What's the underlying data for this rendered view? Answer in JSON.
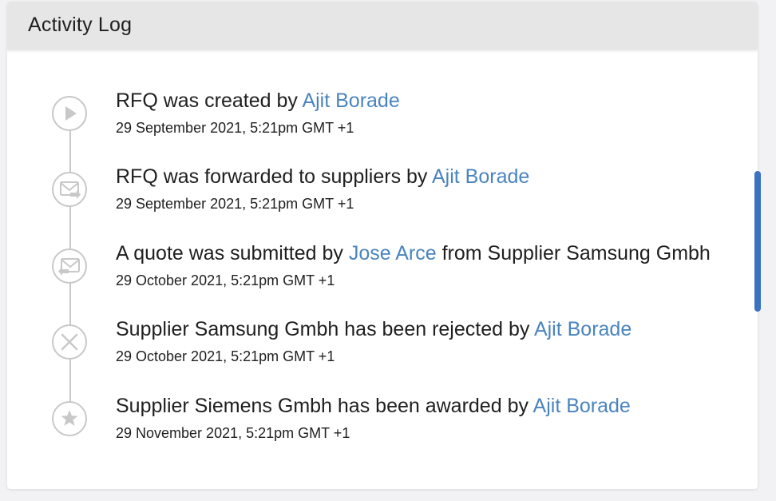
{
  "header": {
    "title": "Activity Log"
  },
  "entries": [
    {
      "icon": "play-icon",
      "text_before": "RFQ was created by ",
      "user": "Ajit Borade",
      "text_after": "",
      "date": "29 September 2021, 5:21pm GMT +1"
    },
    {
      "icon": "mail-forward-icon",
      "text_before": "RFQ was forwarded to suppliers by ",
      "user": "Ajit Borade",
      "text_after": "",
      "date": "29 September 2021, 5:21pm GMT +1"
    },
    {
      "icon": "mail-reply-icon",
      "text_before": "A quote was submitted by ",
      "user": "Jose Arce",
      "text_after": " from Supplier Samsung Gmbh",
      "date": "29 October 2021, 5:21pm GMT +1"
    },
    {
      "icon": "close-circle-icon",
      "text_before": "Supplier Samsung Gmbh has been rejected by ",
      "user": "Ajit Borade",
      "text_after": "",
      "date": "29 October 2021, 5:21pm GMT +1"
    },
    {
      "icon": "star-icon",
      "text_before": "Supplier Siemens Gmbh has been awarded by ",
      "user": "Ajit Borade",
      "text_after": "",
      "date": "29 November 2021, 5:21pm GMT +1"
    }
  ],
  "colors": {
    "link": "#4a84bf",
    "icon_stroke": "#c8c8c8",
    "header_bg": "#e6e6e6",
    "scrollbar": "#3a72c0"
  }
}
